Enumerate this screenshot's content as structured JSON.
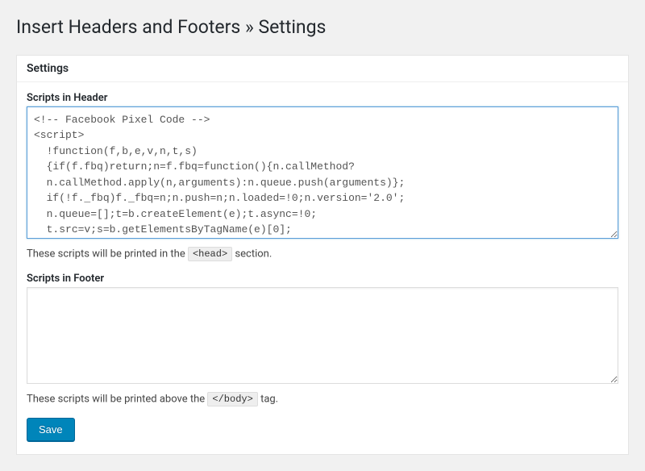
{
  "page": {
    "title": "Insert Headers and Footers » Settings"
  },
  "panel": {
    "heading": "Settings"
  },
  "fields": {
    "header": {
      "label": "Scripts in Header",
      "value": "<!-- Facebook Pixel Code -->\n<script>\n  !function(f,b,e,v,n,t,s)\n  {if(f.fbq)return;n=f.fbq=function(){n.callMethod?\n  n.callMethod.apply(n,arguments):n.queue.push(arguments)};\n  if(!f._fbq)f._fbq=n;n.push=n;n.loaded=!0;n.version='2.0';\n  n.queue=[];t=b.createElement(e);t.async=!0;\n  t.src=v;s=b.getElementsByTagName(e)[0];",
      "desc_prefix": "These scripts will be printed in the ",
      "desc_code": "<head>",
      "desc_suffix": " section."
    },
    "footer": {
      "label": "Scripts in Footer",
      "value": "",
      "desc_prefix": "These scripts will be printed above the ",
      "desc_code": "</body>",
      "desc_suffix": " tag."
    }
  },
  "actions": {
    "save": "Save"
  }
}
